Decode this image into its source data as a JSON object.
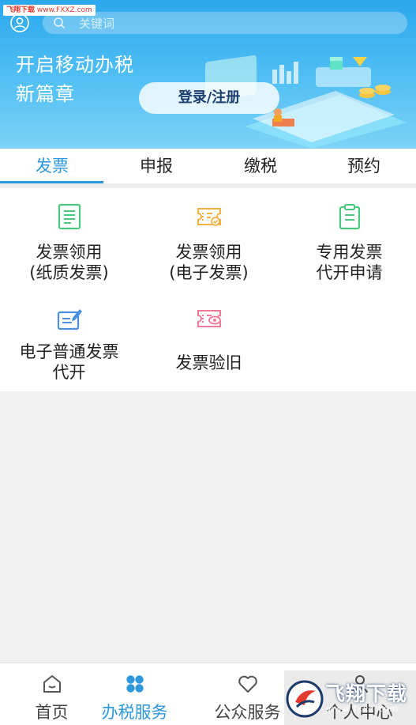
{
  "watermark": {
    "brand": "飞翔下载",
    "url": "www.FXXZ.com"
  },
  "header": {
    "search_placeholder": "关键词",
    "slogan_line1": "开启移动办税",
    "slogan_line2": "新篇章",
    "login_label": "登录/注册"
  },
  "tabs": [
    {
      "label": "发票",
      "active": true
    },
    {
      "label": "申报",
      "active": false
    },
    {
      "label": "缴税",
      "active": false
    },
    {
      "label": "预约",
      "active": false
    }
  ],
  "services": [
    {
      "line1": "发票领用",
      "line2": "(纸质发票)",
      "icon": "document-icon",
      "color": "#4cc77e"
    },
    {
      "line1": "发票领用",
      "line2": "(电子发票)",
      "icon": "e-invoice-icon",
      "color": "#f2b246"
    },
    {
      "line1": "专用发票",
      "line2": "代开申请",
      "icon": "clipboard-icon",
      "color": "#4cc77e"
    },
    {
      "line1": "电子普通发票",
      "line2": "代开",
      "icon": "edit-invoice-icon",
      "color": "#4a8fe0"
    },
    {
      "line1": "发票验旧",
      "line2": "",
      "icon": "invoice-check-icon",
      "color": "#f07a9b"
    }
  ],
  "bottom_nav": [
    {
      "label": "首页",
      "icon": "home-icon",
      "active": false
    },
    {
      "label": "办税服务",
      "icon": "grid-icon",
      "active": true
    },
    {
      "label": "公众服务",
      "icon": "heart-icon",
      "active": false
    },
    {
      "label": "个人中心",
      "icon": "person-icon",
      "active": false
    }
  ],
  "watermark_badge": {
    "brand": "飞翔下载",
    "url": "www.fxxz.com"
  },
  "colors": {
    "accent": "#2f97dc",
    "header_top": "#2ba7ec",
    "header_bottom": "#7dd3f7"
  }
}
